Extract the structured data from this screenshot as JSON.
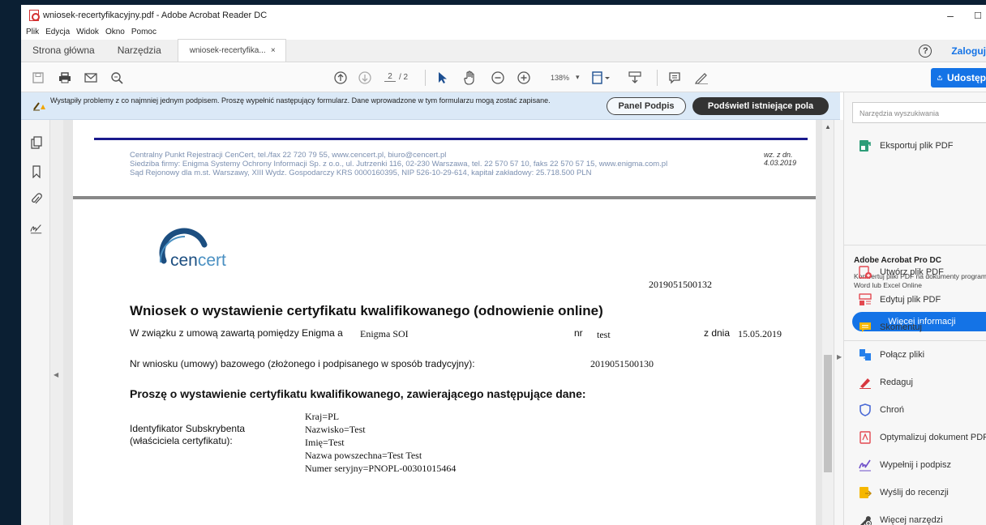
{
  "window": {
    "title": "wniosek-recertyfikacyjny.pdf - Adobe Acrobat Reader DC",
    "minimize_glyph": "–",
    "maximize_glyph": "☐"
  },
  "menu": [
    "Plik",
    "Edycja",
    "Widok",
    "Okno",
    "Pomoc"
  ],
  "tabs": {
    "home": "Strona główna",
    "tools": "Narzędzia",
    "document": "wniosek-recertyfika...",
    "close_glyph": "×",
    "help_glyph": "?",
    "signin": "Zaloguj"
  },
  "toolbar": {
    "page_current": "2",
    "page_total": "/ 2",
    "zoom": "138%",
    "zoom_caret": "▾",
    "share": "Udostęp"
  },
  "notice": {
    "text": "Wystąpiły problemy z co najmniej jednym podpisem. Proszę wypełnić następujący formularz. Dane wprowadzone w tym formularzu mogą zostać zapisane.",
    "panel_button": "Panel Podpis",
    "highlight_button": "Podświetl istniejące pola"
  },
  "document": {
    "header_lines": [
      "Centralny Punkt Rejestracji CenCert, tel./fax 22 720 79 55, www.cencert.pl, biuro@cencert.pl",
      "Siedziba firmy: Enigma Systemy Ochrony Informacji Sp. z o.o., ul. Jutrzenki 116, 02-230 Warszawa, tel. 22 570 57 10, faks 22 570 57 15, www.enigma.com.pl",
      "Sąd Rejonowy dla m.st. Warszawy, XIII Wydz. Gospodarczy KRS 0000160395, NIP 526-10-29-614, kapitał zakładowy: 25.718.500 PLN"
    ],
    "header_date": "wz. z dn. 4.03.2019",
    "logo_prefix": "cen",
    "logo_suffix": "cert",
    "request_number": "2019051500132",
    "title": "Wniosek o wystawienie certyfikatu kwalifikowanego (odnowienie online)",
    "agreement_label": "W związku z umową zawartą pomiędzy Enigma a",
    "agreement_party": "Enigma SOI",
    "nr_label": "nr",
    "nr_value": "test",
    "date_label": "z dnia",
    "date_value": "15.05.2019",
    "base_label": "Nr wniosku (umowy) bazowego (złożonego i podpisanego  w sposób tradycyjny):",
    "base_value": "2019051500130",
    "section_title": "Proszę o wystawienie certyfikatu kwalifikowanego, zawierającego następujące dane:",
    "identifier_label_1": "Identyfikator Subskrybenta",
    "identifier_label_2": "(właściciela certyfikatu):",
    "fields": [
      "Kraj=PL",
      "Nazwisko=Test",
      "Imię=Test",
      "Nazwa powszechna=Test Test",
      "Numer seryjny=PNOPL-00301015464"
    ]
  },
  "right_pane": {
    "search_placeholder": "Narzędzia wyszukiwania",
    "export": "Eksportuj plik PDF",
    "promo_title": "Adobe Acrobat Pro DC",
    "promo_desc": "Konwertuj pliki PDF na dokumenty programu Word lub Excel Online",
    "promo_button": "Więcej informacji",
    "tools": [
      "Utwórz plik PDF",
      "Edytuj plik PDF",
      "Skomentuj",
      "Połącz pliki",
      "Redaguj",
      "Chroń",
      "Optymalizuj dokument PDF",
      "Wypełnij i podpisz",
      "Wyślij do recenzji",
      "Więcej narzędzi"
    ]
  },
  "colors": {
    "accent": "#1473e6",
    "notice_bg": "#dbe9f7",
    "pdf_red": "#d32f2f"
  }
}
